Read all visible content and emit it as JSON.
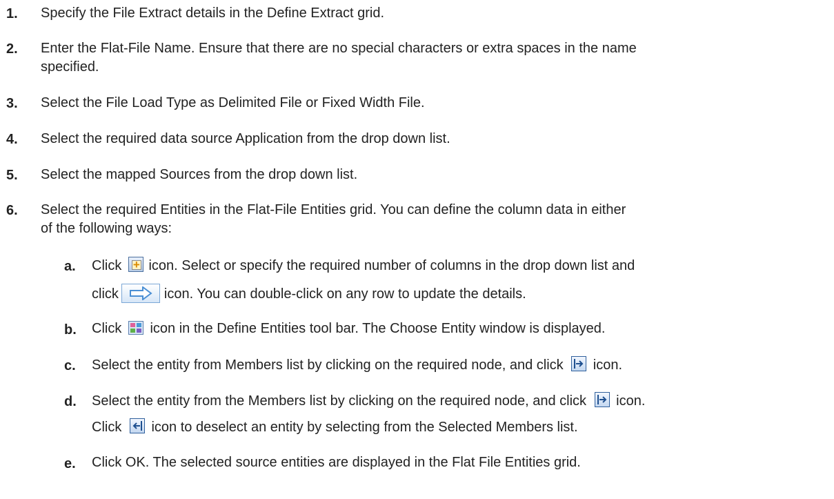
{
  "steps": [
    {
      "num": "1.",
      "lines": [
        "Specify the File Extract details in the Define Extract grid."
      ]
    },
    {
      "num": "2.",
      "lines": [
        "Enter the Flat-File Name. Ensure that there are no special characters or extra spaces in the name",
        "specified."
      ]
    },
    {
      "num": "3.",
      "lines": [
        "Select the File Load Type as Delimited File or Fixed Width File."
      ]
    },
    {
      "num": "4.",
      "lines": [
        "Select the required data source Application from the drop down list."
      ]
    },
    {
      "num": "5.",
      "lines": [
        "Select the mapped Sources from the drop down list."
      ]
    },
    {
      "num": "6.",
      "lines": [
        "Select the required Entities in the Flat-File Entities grid. You can define the column data in either",
        "of the following ways:"
      ]
    }
  ],
  "substeps": {
    "a": {
      "num": "a.",
      "l1_before": "Click",
      "l1_after": "icon. Select or specify the required number of columns in the drop down list and",
      "l2_before": "click",
      "l2_after": "icon. You can double-click on any row to update the details."
    },
    "b": {
      "num": "b.",
      "before": "Click",
      "after": "icon in the Define Entities tool bar. The Choose Entity window is displayed."
    },
    "c": {
      "num": "c.",
      "before": "Select the entity from Members list by clicking on the required node, and click",
      "after": "icon."
    },
    "d": {
      "num": "d.",
      "l1_before": "Select the entity from the Members list by clicking on the required node, and click",
      "l1_after": "icon.",
      "l2_before": "Click",
      "l2_after": "icon to deselect an entity by selecting from the Selected Members list."
    },
    "e": {
      "num": "e.",
      "text": "Click OK. The selected source entities are displayed in the Flat File Entities grid."
    }
  },
  "icons": {
    "add_row": "add-row-icon",
    "arrow": "arrow-button-icon",
    "entities": "define-entities-icon",
    "select": "select-member-icon",
    "deselect": "deselect-member-icon"
  }
}
